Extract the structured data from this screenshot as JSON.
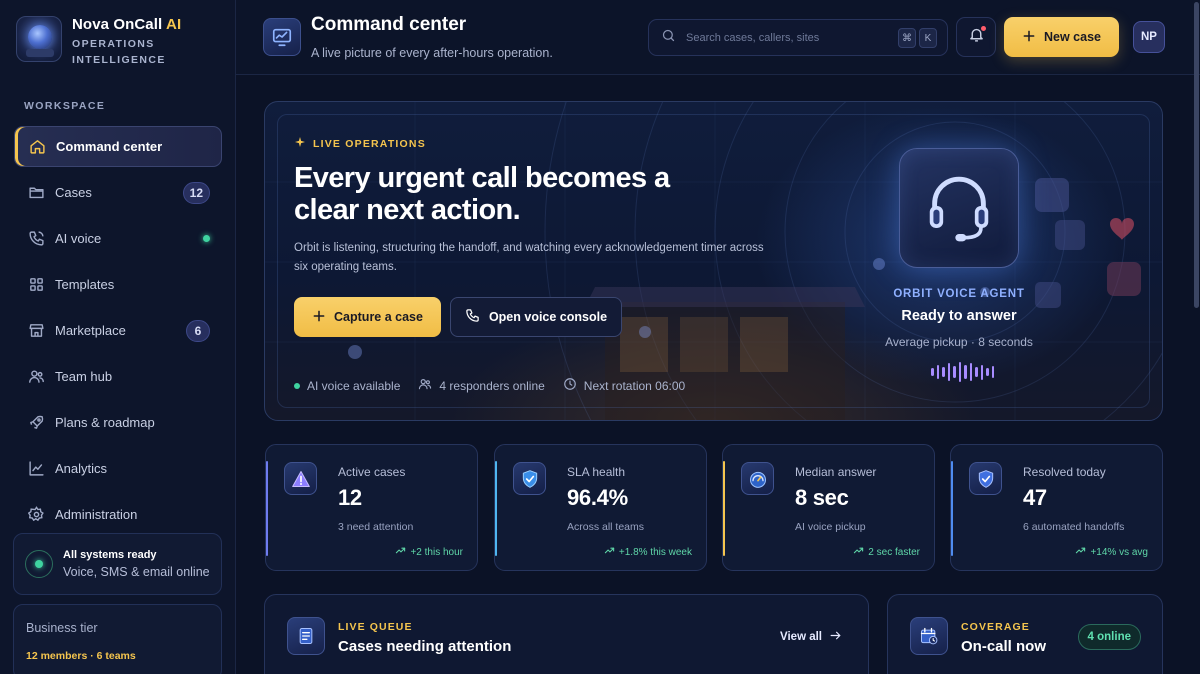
{
  "brand": {
    "name": "Nova OnCall",
    "name_suffix": "AI",
    "subtitle_line1": "OPERATIONS",
    "subtitle_line2": "INTELLIGENCE"
  },
  "sidebar": {
    "section_label": "WORKSPACE",
    "items": [
      {
        "label": "Command center",
        "icon": "home-icon",
        "active": true
      },
      {
        "label": "Cases",
        "icon": "folder-icon",
        "badge": "12"
      },
      {
        "label": "AI voice",
        "icon": "phone-icon",
        "status_dot": true
      },
      {
        "label": "Templates",
        "icon": "grid-icon"
      },
      {
        "label": "Marketplace",
        "icon": "store-icon",
        "badge": "6"
      },
      {
        "label": "Team hub",
        "icon": "users-icon"
      },
      {
        "label": "Plans & roadmap",
        "icon": "rocket-icon"
      },
      {
        "label": "Analytics",
        "icon": "chart-icon"
      },
      {
        "label": "Administration",
        "icon": "gear-icon"
      }
    ],
    "status": {
      "title": "All systems ready",
      "subtitle": "Voice, SMS & email online"
    },
    "tier": {
      "title": "Business tier",
      "subtitle": "12 members · 6 teams"
    }
  },
  "header": {
    "title": "Command center",
    "subtitle": "A live picture of every after-hours operation.",
    "search_placeholder": "Search cases, callers, sites",
    "kbd_1": "⌘",
    "kbd_2": "K",
    "new_case_label": "New case",
    "avatar_initials": "NP"
  },
  "hero": {
    "eyebrow": "LIVE OPERATIONS",
    "title": "Every urgent call becomes a clear next action.",
    "description": "Orbit is listening, structuring the handoff, and watching every acknowledgement timer across six operating teams.",
    "primary_button": "Capture a case",
    "secondary_button": "Open voice console",
    "meta": {
      "voice": "AI voice available",
      "responders": "4 responders online",
      "rotation": "Next rotation 06:00"
    },
    "agent": {
      "label": "ORBIT VOICE AGENT",
      "status": "Ready to answer",
      "pickup": "Average pickup · 8 seconds"
    }
  },
  "kpis": [
    {
      "label": "Active cases",
      "value": "12",
      "note": "3 need attention",
      "trend": "+2 this hour",
      "accent": "#6f7cf0",
      "icon": "alert-triangle-icon"
    },
    {
      "label": "SLA health",
      "value": "96.4%",
      "note": "Across all teams",
      "trend": "+1.8% this week",
      "accent": "#4fb6f0",
      "icon": "shield-check-icon"
    },
    {
      "label": "Median answer",
      "value": "8 sec",
      "note": "AI voice pickup",
      "trend": "2 sec faster",
      "accent": "#f5c54e",
      "icon": "gauge-icon"
    },
    {
      "label": "Resolved today",
      "value": "47",
      "note": "6 automated handoffs",
      "trend": "+14% vs avg",
      "accent": "#4f8cf0",
      "icon": "shield-check-icon"
    }
  ],
  "queue": {
    "eyebrow": "LIVE QUEUE",
    "title": "Cases needing attention",
    "link": "View all"
  },
  "coverage": {
    "eyebrow": "COVERAGE",
    "title": "On-call now",
    "pill": "4 online"
  },
  "colors": {
    "accent": "#f5c54e",
    "success": "#3fd3a0",
    "background": "#0b1226"
  }
}
